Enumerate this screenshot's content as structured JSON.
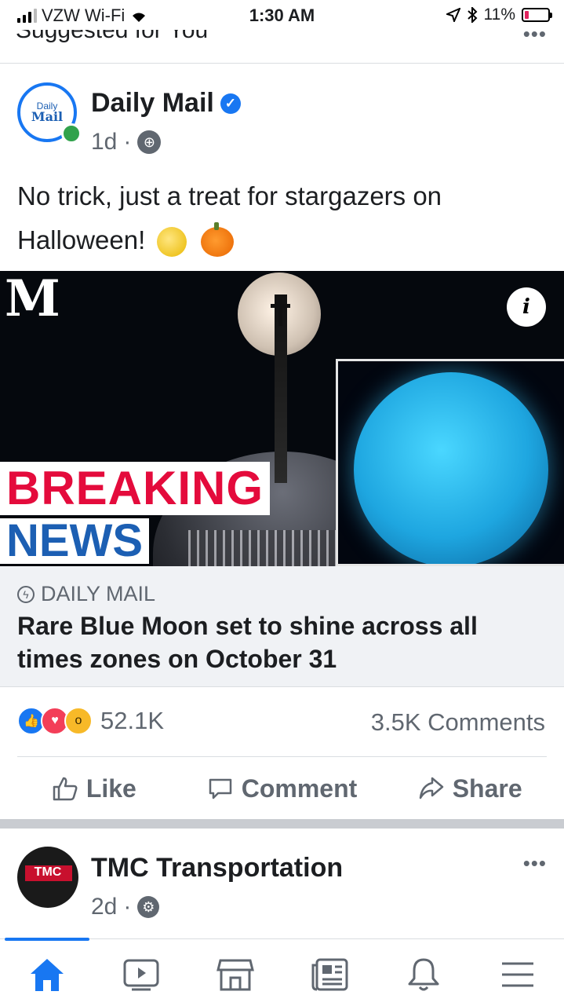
{
  "status_bar": {
    "carrier": "VZW Wi-Fi",
    "time": "1:30 AM",
    "battery": "11%"
  },
  "section_header": {
    "title": "Suggested for You"
  },
  "post": {
    "page_name": "Daily Mail",
    "avatar_line1": "Daily",
    "avatar_line2": "Mail",
    "time": "1d",
    "text": "No trick, just a treat for stargazers on Halloween!",
    "image": {
      "overlay_line1": "BREAKING",
      "overlay_line2": "NEWS",
      "logo_mark": "M"
    },
    "link": {
      "source": "DAILY MAIL",
      "headline": "Rare Blue Moon set to shine across all times zones on October 31"
    },
    "reaction_count": "52.1K",
    "comment_count": "3.5K Comments",
    "actions": {
      "like": "Like",
      "comment": "Comment",
      "share": "Share"
    }
  },
  "next_post": {
    "page_name": "TMC Transportation",
    "avatar_text": "TMC",
    "time": "2d"
  },
  "tab_bar": {
    "active": "home",
    "tabs": [
      "home-icon",
      "watch-icon",
      "marketplace-icon",
      "news-icon",
      "notifications-icon",
      "menu-icon"
    ]
  },
  "colors": {
    "accent": "#1877f2",
    "breaking_red": "#e40b3c",
    "news_blue": "#1c5fb3"
  }
}
